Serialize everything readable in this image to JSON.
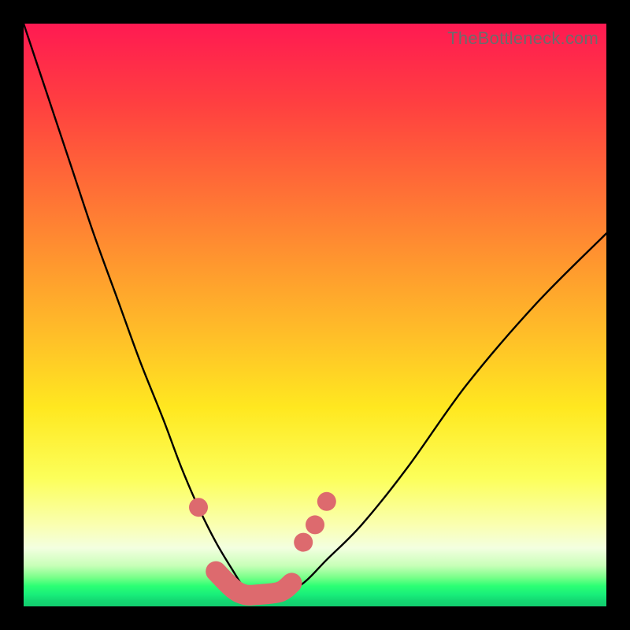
{
  "watermark": "TheBottleneck.com",
  "colors": {
    "curve": "#000000",
    "marker": "#dd6a6e",
    "gradient_top": "#ff1a52",
    "gradient_bottom": "#12cc6e"
  },
  "chart_data": {
    "type": "line",
    "title": "",
    "xlabel": "",
    "ylabel": "",
    "xlim": [
      0,
      100
    ],
    "ylim": [
      0,
      100
    ],
    "grid": false,
    "legend": false,
    "note": "x and y are relative 0–100 (percent of plot width/height from bottom-left); no numeric axes shown in source image",
    "series": [
      {
        "name": "bottleneck-curve",
        "x": [
          0,
          4,
          8,
          12,
          16,
          20,
          24,
          27,
          30,
          33,
          36,
          38,
          40,
          44,
          48,
          52,
          58,
          66,
          76,
          88,
          100
        ],
        "y": [
          100,
          88,
          76,
          64,
          53,
          42,
          32,
          24,
          17,
          11,
          6,
          3,
          2,
          2,
          4,
          8,
          14,
          24,
          38,
          52,
          64
        ]
      }
    ],
    "markers": [
      {
        "name": "left-dot",
        "x": 30,
        "y": 17
      },
      {
        "name": "right-dot-1",
        "x": 48,
        "y": 11
      },
      {
        "name": "right-dot-2",
        "x": 50,
        "y": 14
      },
      {
        "name": "right-dot-3",
        "x": 52,
        "y": 18
      }
    ],
    "trough_segment": {
      "x": [
        33,
        36,
        38,
        40,
        44,
        46
      ],
      "y": [
        6,
        3,
        2,
        2,
        2.5,
        4
      ]
    }
  }
}
